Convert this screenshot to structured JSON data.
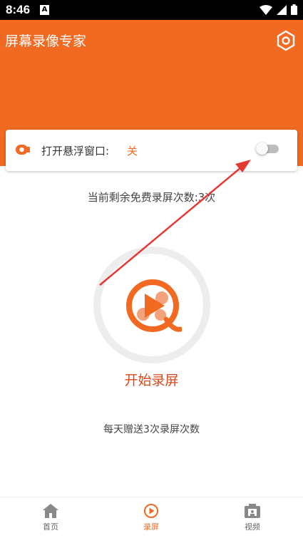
{
  "status_bar": {
    "time": "8:46",
    "a_icon_text": "A"
  },
  "header": {
    "title": "屏幕录像专家"
  },
  "floating_window": {
    "label": "打开悬浮窗口:",
    "state": "关",
    "toggle_on": false
  },
  "remaining_text": "当前剩余免费录屏次数:3次",
  "start_button_label": "开始录屏",
  "daily_text": "每天赠送3次录屏次数",
  "bottom_nav": [
    {
      "label": "首页",
      "icon": "home-icon",
      "active": false
    },
    {
      "label": "录屏",
      "icon": "play-circle-icon",
      "active": true
    },
    {
      "label": "视频",
      "icon": "camera-icon",
      "active": false
    }
  ],
  "colors": {
    "accent": "#f26a21",
    "start_text": "#d9481b",
    "arrow": "#e53935"
  }
}
